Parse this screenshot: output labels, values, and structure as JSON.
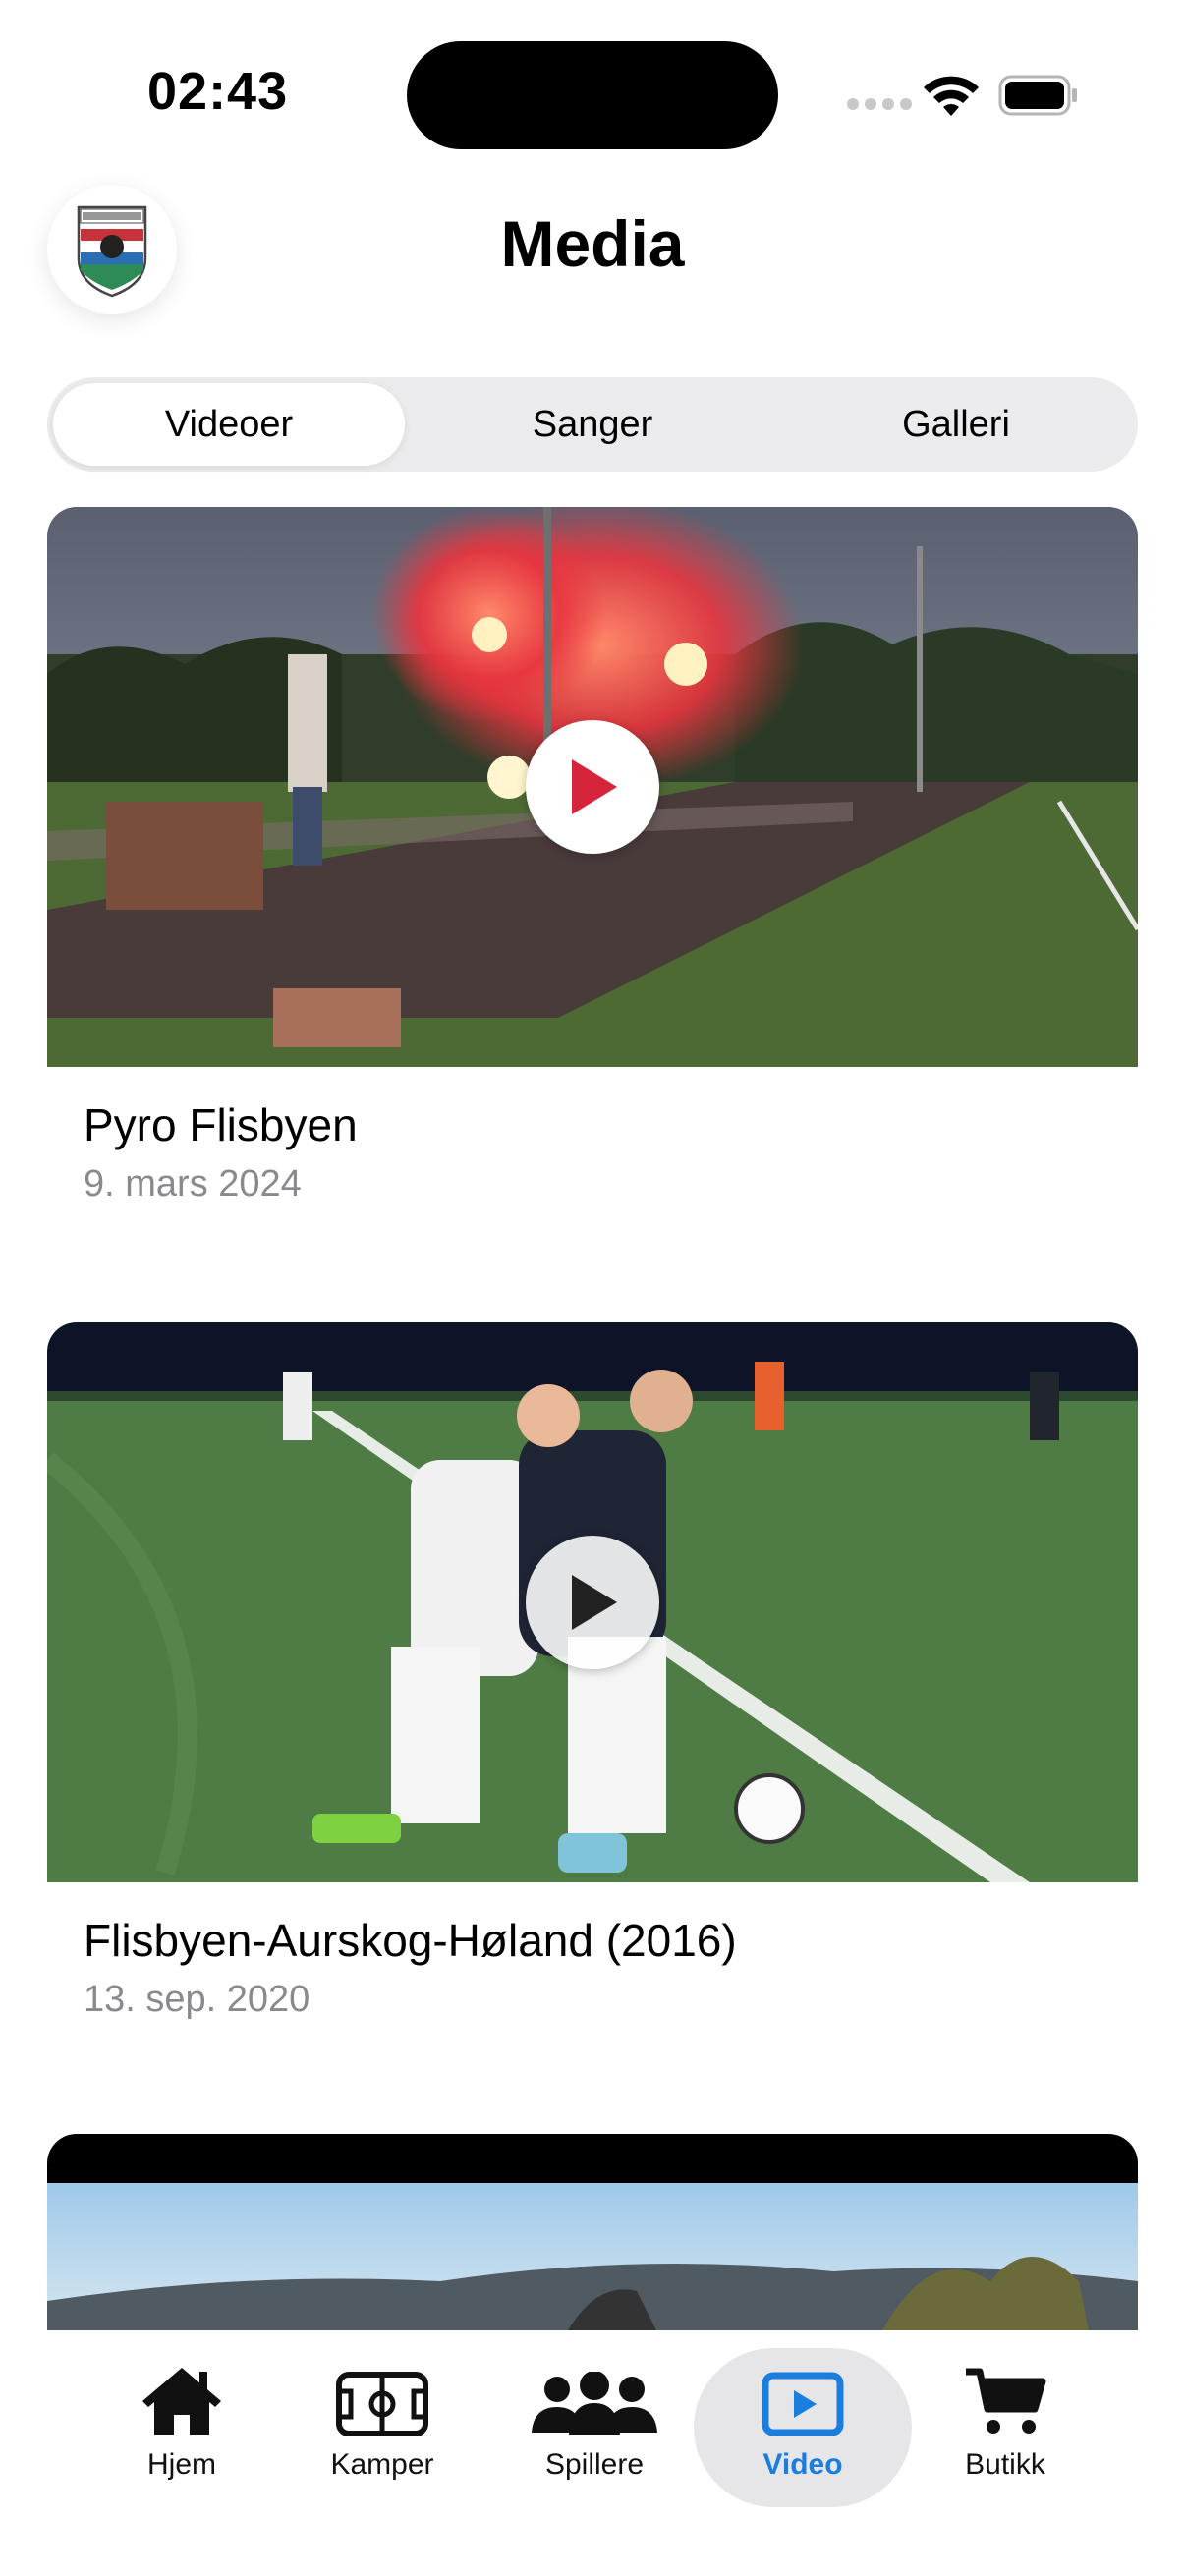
{
  "status_bar": {
    "time": "02:43"
  },
  "header": {
    "title": "Media",
    "logo_icon": "club-crest-icon"
  },
  "segments": [
    {
      "label": "Videoer",
      "active": true
    },
    {
      "label": "Sanger",
      "active": false
    },
    {
      "label": "Galleri",
      "active": false
    }
  ],
  "videos": [
    {
      "title": "Pyro Flisbyen",
      "date": "9. mars 2024"
    },
    {
      "title": "Flisbyen-Aurskog-Høland (2016)",
      "date": "13. sep. 2020"
    },
    {
      "title": "",
      "date": ""
    }
  ],
  "tabbar": {
    "items": [
      {
        "label": "Hjem",
        "icon": "house-icon"
      },
      {
        "label": "Kamper",
        "icon": "football-pitch-icon"
      },
      {
        "label": "Spillere",
        "icon": "people-icon"
      },
      {
        "label": "Video",
        "icon": "play-rectangle-icon",
        "active": true
      },
      {
        "label": "Butikk",
        "icon": "cart-icon"
      }
    ]
  },
  "colors": {
    "accent": "#1a7de0",
    "muted": "#8a8a8e",
    "segment_bg": "#ebebed"
  }
}
